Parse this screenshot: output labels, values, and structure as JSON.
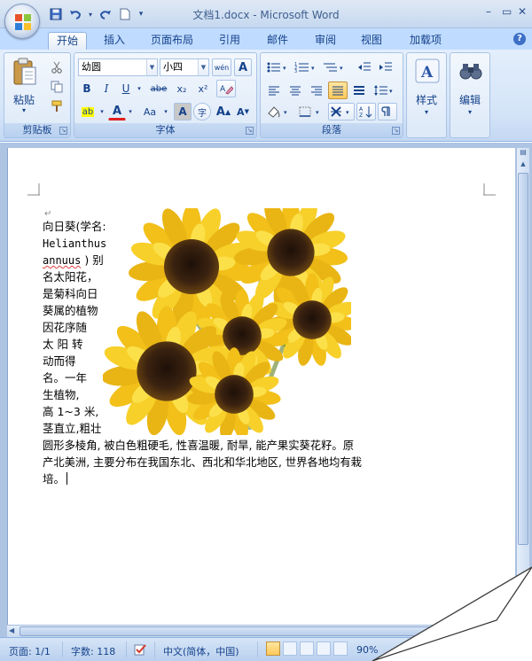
{
  "window": {
    "title": "文档1.docx - Microsoft Word",
    "controls": {
      "minimize": "–",
      "restore": "▭",
      "close": "✕"
    }
  },
  "quick_access": {
    "save_icon": "save-icon",
    "undo_icon": "undo-icon",
    "redo_icon": "redo-icon",
    "new_icon": "new-doc-icon"
  },
  "tabs": [
    {
      "label": "开始",
      "active": true
    },
    {
      "label": "插入"
    },
    {
      "label": "页面布局"
    },
    {
      "label": "引用"
    },
    {
      "label": "邮件"
    },
    {
      "label": "审阅"
    },
    {
      "label": "视图"
    },
    {
      "label": "加载项"
    }
  ],
  "ribbon": {
    "clipboard": {
      "label": "剪贴板",
      "paste_label": "粘贴"
    },
    "font": {
      "label": "字体",
      "font_name": "幼圆",
      "font_size": "小四",
      "wen_label": "wén",
      "a_box": "A",
      "bold": "B",
      "italic": "I",
      "underline": "U",
      "strike": "abe",
      "subscript": "x₂",
      "superscript": "x²",
      "highlight": "ab",
      "font_color": "A",
      "change_case": "Aa",
      "char_shading": "A",
      "enclose": "字",
      "grow": "A",
      "shrink": "A"
    },
    "paragraph": {
      "label": "段落"
    },
    "styles": {
      "label": "样式"
    },
    "editing": {
      "label": "编辑"
    }
  },
  "document": {
    "lines_left": [
      "向日葵(学名:",
      "Helianthus",
      "annuus",
      "名太阳花，",
      "是菊科向日",
      "葵属的植物",
      "因花序随",
      "太 阳 转",
      "动而得",
      "名。一年",
      "生植物,",
      "高 1~3 米,",
      "茎直立,粗壮"
    ],
    "annuus_suffix": ") 别",
    "lines_full": [
      "圆形多棱角, 被白色粗硬毛, 性喜温暖, 耐旱, 能产果实葵花籽。原",
      "产北美洲, 主要分布在我国东北、西北和华北地区, 世界各地均有栽",
      "培。"
    ],
    "para_mark": "↵"
  },
  "status": {
    "page": "页面: 1/1",
    "words": "字数: 118",
    "language": "中文(简体，中国)",
    "zoom": "90%"
  },
  "colors": {
    "ribbon_bg": "#d4e4f8",
    "tab_row": "#bfdbff",
    "petal": "#f2c019",
    "center": "#3a2210"
  }
}
